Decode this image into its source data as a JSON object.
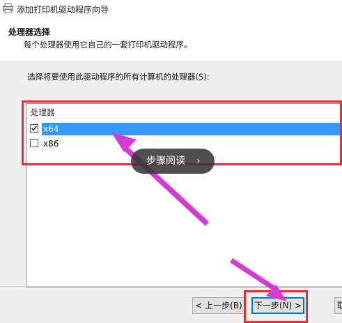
{
  "window": {
    "title": "添加打印机驱动程序向导",
    "icon": "printer-icon"
  },
  "header": {
    "title": "处理器选择",
    "subtitle": "每个处理器使用它自己的一套打印机驱动程序。"
  },
  "instruction": "选择将要使用此驱动程序的所有计算机的处理器(S):",
  "processor_list": {
    "column_header": "处理器",
    "items": [
      {
        "label": "x64",
        "checked": true,
        "selected": true
      },
      {
        "label": "x86",
        "checked": false,
        "selected": false
      }
    ]
  },
  "overlay": {
    "label": "步骤阅读",
    "chevron": "›"
  },
  "buttons": {
    "back": "< 上一步(B)",
    "next": "下一步(N) >",
    "cancel": "取"
  },
  "colors": {
    "annotation_red": "#e0303a",
    "arrow_magenta": "#d63ad6",
    "selection_blue": "#3399ff"
  }
}
